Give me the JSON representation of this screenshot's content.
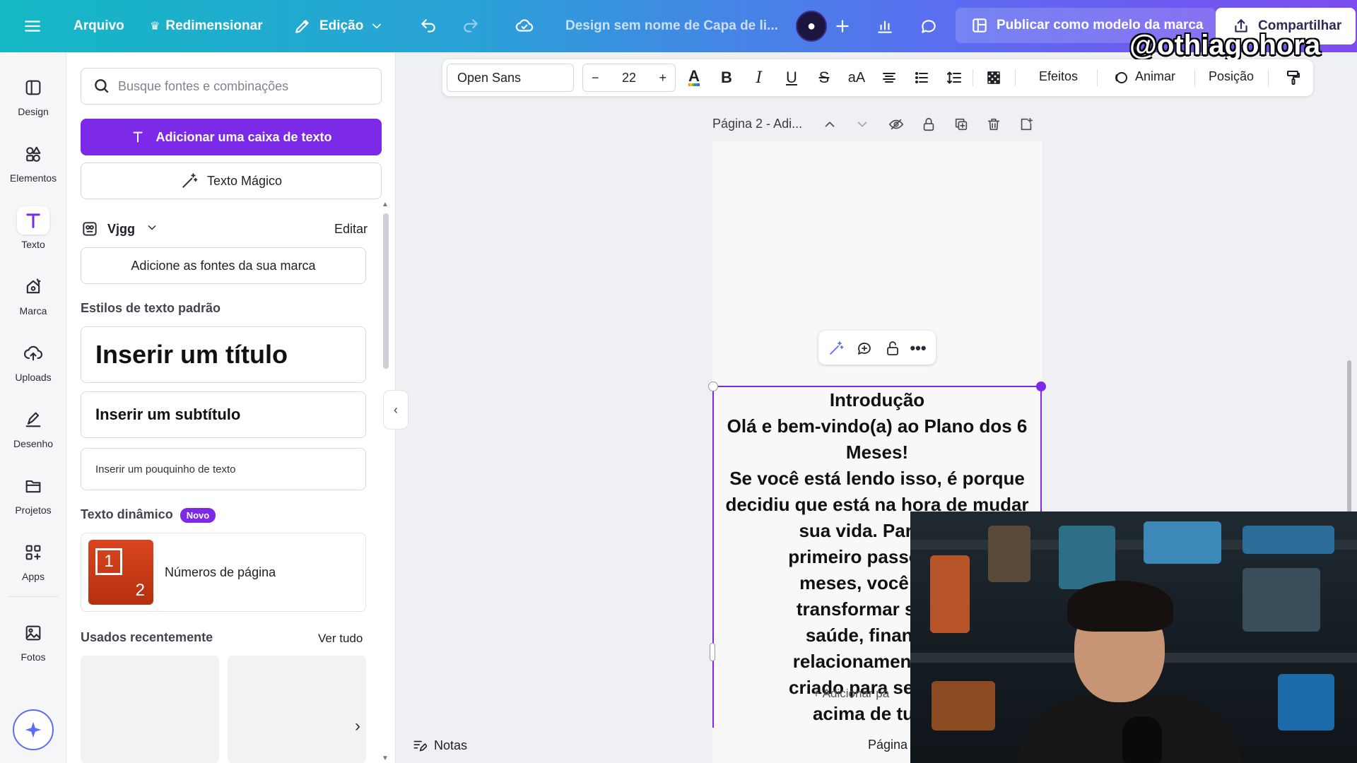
{
  "topbar": {
    "menu_icon": "hamburger-icon",
    "file_label": "Arquivo",
    "resize_label": "Redimensionar",
    "edit_label": "Edição",
    "doc_title": "Design sem nome de Capa de li...",
    "publish_label": "Publicar como modelo da marca",
    "share_label": "Compartilhar",
    "watermark": "@othiagohora",
    "gradient_colors": [
      "#14b8c4",
      "#2aa1d8",
      "#5b6df0",
      "#7d4bf0"
    ]
  },
  "rail": {
    "items": [
      {
        "label": "Design",
        "icon": "layout-icon"
      },
      {
        "label": "Elementos",
        "icon": "shapes-icon"
      },
      {
        "label": "Texto",
        "icon": "text-icon",
        "active": true
      },
      {
        "label": "Marca",
        "icon": "brand-icon"
      },
      {
        "label": "Uploads",
        "icon": "cloud-upload-icon"
      },
      {
        "label": "Desenho",
        "icon": "pen-icon"
      },
      {
        "label": "Projetos",
        "icon": "folder-icon"
      },
      {
        "label": "Apps",
        "icon": "apps-icon"
      },
      {
        "label": "Fotos",
        "icon": "image-icon"
      }
    ]
  },
  "panel": {
    "search_placeholder": "Busque fontes e combinações",
    "add_textbox_label": "Adicionar uma caixa de texto",
    "magic_text_label": "Texto Mágico",
    "brand_kit_name": "Vjgg",
    "brand_edit_label": "Editar",
    "add_brand_fonts_label": "Adicione as fontes da sua marca",
    "default_styles_title": "Estilos de texto padrão",
    "heading_sample": "Inserir um título",
    "subheading_sample": "Inserir um subtítulo",
    "body_sample": "Inserir um pouquinho de texto",
    "dynamic_text_title": "Texto dinâmico",
    "new_badge": "Novo",
    "page_numbers_label": "Números de página",
    "page_numbers_thumb": [
      "1",
      "2"
    ],
    "recent_title": "Usados recentemente",
    "see_all_label": "Ver tudo"
  },
  "format_toolbar": {
    "font_name": "Open Sans",
    "font_size": "22",
    "decrease_label": "−",
    "increase_label": "+",
    "effects_label": "Efeitos",
    "animate_label": "Animar",
    "position_label": "Posição",
    "accent_color": "#7d2ae8"
  },
  "canvas": {
    "page_header": "Página 2 - Adi...",
    "text_lines": "Introdução\nOlá e bem-vindo(a) ao Plano dos 6\nMeses!\nSe você está lendo isso, é porque\ndecidiu que está na hora de mudar\nsua vida. Parabén\nprimeiro passo! Nos\nmeses, você vai a\ntransformar sua m\nsaúde, finanças,\nrelacionamentos. E\ncriado para ser práti\nacima de tudo,",
    "add_page_ghost": "+ Adicionar pá"
  },
  "bottom": {
    "notes_label": "Notas",
    "page_label": "Página"
  }
}
